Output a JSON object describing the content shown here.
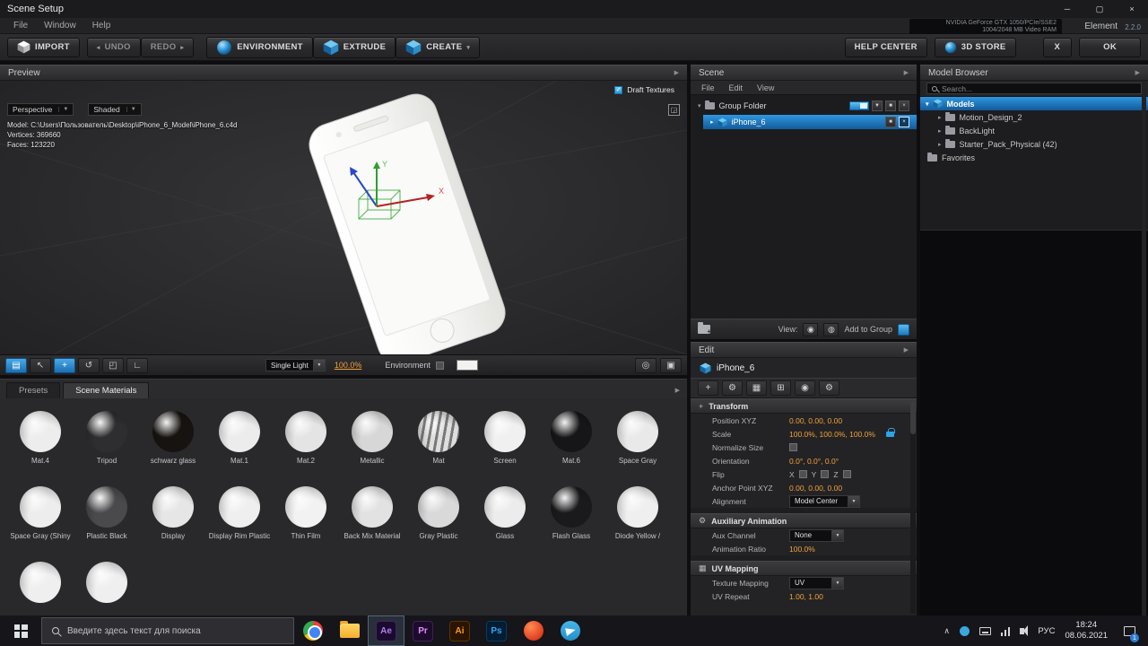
{
  "colors": {
    "accent_blue": "#1d82cc",
    "selection_blue": "#2f97e0",
    "value_orange": "#f2a23a"
  },
  "titlebar": {
    "title": "Scene Setup"
  },
  "menubar": {
    "items": [
      "File",
      "Window",
      "Help"
    ],
    "gpu_line1": "NVIDIA GeForce GTX 1050/PCIe/SSE2",
    "gpu_line2": "1004/2048 MB Video RAM",
    "brand": "Element",
    "version": "2.2.0"
  },
  "toolbar": {
    "import": "IMPORT",
    "undo": "UNDO",
    "redo": "REDO",
    "environment": "ENVIRONMENT",
    "extrude": "EXTRUDE",
    "create": "CREATE",
    "help_center": "HELP CENTER",
    "store": "3D STORE",
    "cancel": "X",
    "ok": "OK"
  },
  "preview": {
    "title": "Preview",
    "camera_dropdown": "Perspective",
    "shading_dropdown": "Shaded",
    "draft_textures_label": "Draft Textures",
    "model_line": "Model: C:\\Users\\Пользователь\\Desktop\\iPhone_6_Model\\iPhone_6.c4d",
    "vertices_line": "Vertices: 369660",
    "faces_line": "Faces: 123220",
    "light_dropdown": "Single Light",
    "light_intensity": "100.0%",
    "environment_label": "Environment",
    "axis_labels": {
      "x": "X",
      "y": "Y"
    }
  },
  "materials": {
    "tab_presets": "Presets",
    "tab_scene": "Scene Materials",
    "items": [
      {
        "name": "Mat.4",
        "color": "#ededed"
      },
      {
        "name": "Tripod",
        "color": "#2e2e30"
      },
      {
        "name": "schwarz glass",
        "color": "#171310"
      },
      {
        "name": "Mat.1",
        "color": "#ececec"
      },
      {
        "name": "Mat.2",
        "color": "#e4e4e4"
      },
      {
        "name": "Metallic",
        "color": "#d7d7d7"
      },
      {
        "name": "Mat",
        "color": "#dedede",
        "striped": true
      },
      {
        "name": "Screen",
        "color": "#f0f0f0"
      },
      {
        "name": "Mat.6",
        "color": "#161618"
      },
      {
        "name": "Space Gray",
        "color": "#e9e9e9"
      },
      {
        "name": "Space Gray (Shiny",
        "color": "#ededed"
      },
      {
        "name": "Plastic Black",
        "color": "#4a4a4c"
      },
      {
        "name": "Display",
        "color": "#e6e6e6"
      },
      {
        "name": "Display Rim Plastic",
        "color": "#efefef"
      },
      {
        "name": "Thin Film",
        "color": "#f2f2f2"
      },
      {
        "name": "Back Mix Material",
        "color": "#e2e2e2"
      },
      {
        "name": "Gray Plastic",
        "color": "#d9d9d9"
      },
      {
        "name": "Glass",
        "color": "#ececec"
      },
      {
        "name": "Flash Glass",
        "color": "#1a1a1c"
      },
      {
        "name": "Diode Yellow /",
        "color": "#efefef"
      },
      {
        "name": "",
        "color": "#efefef"
      },
      {
        "name": "",
        "color": "#efefef"
      }
    ]
  },
  "scene": {
    "title": "Scene",
    "menu": {
      "file": "File",
      "edit": "Edit",
      "view": "View"
    },
    "group_row": {
      "label": "Group Folder"
    },
    "model_row": {
      "label": "iPhone_6"
    },
    "view_label": "View:",
    "add_to_group_label": "Add to Group"
  },
  "edit": {
    "title": "Edit",
    "object_name": "iPhone_6",
    "transform": {
      "title": "Transform",
      "position_label": "Position XYZ",
      "position_values": "0.00,  0.00,  0.00",
      "scale_label": "Scale",
      "scale_values": "100.0%,  100.0%,  100.0%",
      "normalize_label": "Normalize Size",
      "orientation_label": "Orientation",
      "orientation_values": "0.0°,  0.0°,  0.0°",
      "flip_label": "Flip",
      "flip_x": "X",
      "flip_y": "Y",
      "flip_z": "Z",
      "anchor_label": "Anchor Point XYZ",
      "anchor_values": "0.00,  0.00,  0.00",
      "alignment_label": "Alignment",
      "alignment_value": "Model Center"
    },
    "aux": {
      "title": "Auxiliary Animation",
      "channel_label": "Aux Channel",
      "channel_value": "None",
      "ratio_label": "Animation Ratio",
      "ratio_value": "100.0%"
    },
    "uv": {
      "title": "UV Mapping",
      "mapping_label": "Texture Mapping",
      "mapping_value": "UV",
      "repeat_label": "UV Repeat",
      "repeat_values": "1.00,  1.00"
    }
  },
  "model_browser": {
    "title": "Model Browser",
    "search_placeholder": "Search...",
    "root": "Models",
    "children": [
      "Motion_Design_2",
      "BackLight",
      "Starter_Pack_Physical (42)"
    ],
    "favorites": "Favorites"
  },
  "taskbar": {
    "search_placeholder": "Введите здесь текст для поиска",
    "apps": [
      "chrome",
      "file-explorer",
      "after-effects",
      "premiere-pro",
      "illustrator",
      "photoshop",
      "red-app",
      "telegram"
    ],
    "ae_label": "Ae",
    "pr_label": "Pr",
    "ai_label": "Ai",
    "ps_label": "Ps",
    "tray_icons": [
      "chevron-up",
      "telegram",
      "keyboard",
      "network",
      "volume"
    ],
    "language": "РУС",
    "time": "18:24",
    "date": "08.06.2021",
    "notification_count": "1"
  }
}
